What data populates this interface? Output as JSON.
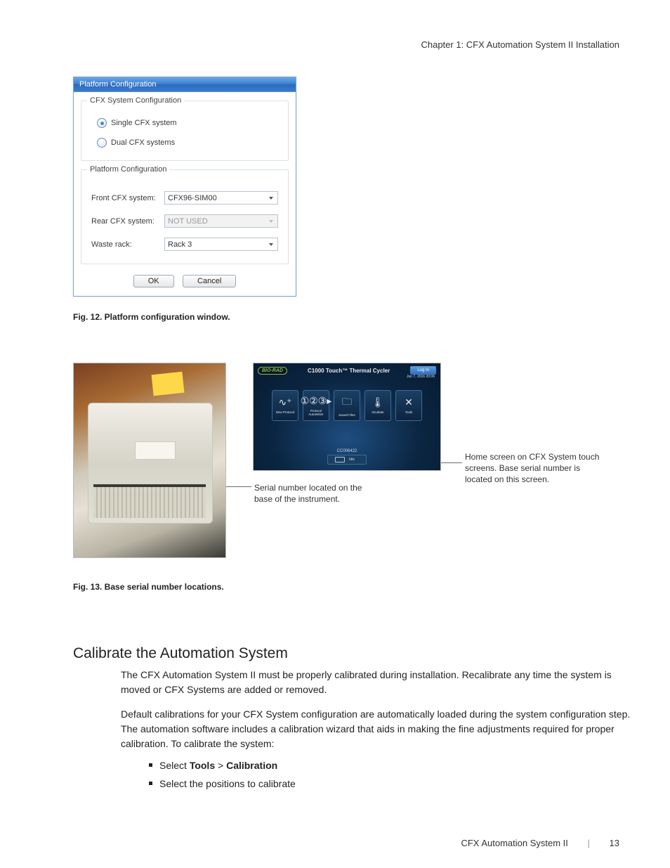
{
  "header": {
    "chapter": "Chapter 1: CFX Automation System II Installation"
  },
  "dialog": {
    "title": "Platform Configuration",
    "group1": {
      "legend": "CFX System Configuration",
      "opt1": "Single CFX system",
      "opt2": "Dual CFX systems"
    },
    "group2": {
      "legend": "Platform Configuration",
      "row1_label": "Front CFX system:",
      "row1_value": "CFX96-SIM00",
      "row2_label": "Rear CFX system:",
      "row2_value": "NOT USED",
      "row3_label": "Waste rack:",
      "row3_value": "Rack 3"
    },
    "ok": "OK",
    "cancel": "Cancel"
  },
  "fig12": {
    "label": "Fig. 12. Platform configuration window."
  },
  "fig13": {
    "note_left": "Serial number located on the base of the instrument.",
    "note_right": "Home screen on CFX System touch screens. Base serial number is located on this screen.",
    "label": "Fig. 13. Base serial number locations.",
    "touchscreen": {
      "logo": "BIO-RAD",
      "title": "C1000 Touch™ Thermal Cycler",
      "login": "Log In",
      "date": "Jun 7, 2016  20:06",
      "icons": {
        "new_protocol": "New Protocol",
        "autowriter": "Protocol AutoWriter",
        "saved_files": "Saved Files",
        "incubate": "Incubate",
        "tools": "Tools"
      },
      "serial": "CC006422",
      "status": "Idle"
    }
  },
  "section": {
    "heading": "Calibrate the Automation System",
    "p1": "The CFX Automation System II must be properly calibrated during installation. Recalibrate any time the system is moved or CFX Systems are added or removed.",
    "p2": "Default calibrations for your CFX System configuration are automatically loaded during the system configuration step. The automation software includes a calibration wizard that aids in making the fine adjustments required for proper calibration. To calibrate the system:",
    "bullets": {
      "b1_pre": "Select ",
      "b1_tools": "Tools",
      "b1_gt": " > ",
      "b1_calib": "Calibration",
      "b2": "Select the positions to calibrate"
    }
  },
  "footer": {
    "product": "CFX Automation System II",
    "page": "13"
  }
}
